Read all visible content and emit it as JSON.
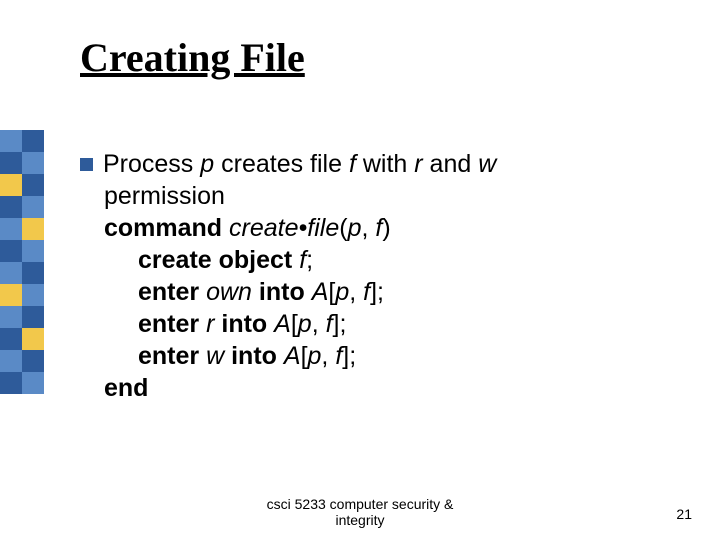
{
  "title": "Creating File",
  "bullet": {
    "lead1_a": "Process ",
    "lead1_b": "p",
    "lead1_c": " creates file ",
    "lead1_d": "f",
    "lead1_e": " with ",
    "lead1_f": "r",
    "lead1_g": " and ",
    "lead1_h": "w",
    "lead2": "permission",
    "cmd_a": "command ",
    "cmd_b": "create•file",
    "cmd_c": "(",
    "cmd_d": "p",
    "cmd_e": ", ",
    "cmd_f": "f",
    "cmd_g": ")",
    "l1_a": "create object ",
    "l1_b": "f",
    "l1_c": ";",
    "l2_a": "enter ",
    "l2_b": "own",
    "l2_c": " into ",
    "l2_d": "A",
    "l2_e": "[",
    "l2_f": "p",
    "l2_g": ", ",
    "l2_h": "f",
    "l2_i": "];",
    "l3_a": "enter ",
    "l3_b": "r",
    "l3_c": " into ",
    "l3_d": "A",
    "l3_e": "[",
    "l3_f": "p",
    "l3_g": ", ",
    "l3_h": "f",
    "l3_i": "];",
    "l4_a": "enter ",
    "l4_b": "w",
    "l4_c": " into ",
    "l4_d": "A",
    "l4_e": "[",
    "l4_f": "p",
    "l4_g": ", ",
    "l4_h": "f",
    "l4_i": "];",
    "end": "end"
  },
  "footer": {
    "line1": "csci 5233 computer security &",
    "line2": "integrity"
  },
  "pagenum": "21",
  "sidebar_colors": [
    [
      "#5a8ac6",
      "#2e5b9a"
    ],
    [
      "#2e5b9a",
      "#5a8ac6"
    ],
    [
      "#f2c84b",
      "#2e5b9a"
    ],
    [
      "#2e5b9a",
      "#5a8ac6"
    ],
    [
      "#5a8ac6",
      "#f2c84b"
    ],
    [
      "#2e5b9a",
      "#5a8ac6"
    ],
    [
      "#5a8ac6",
      "#2e5b9a"
    ],
    [
      "#f2c84b",
      "#5a8ac6"
    ],
    [
      "#5a8ac6",
      "#2e5b9a"
    ],
    [
      "#2e5b9a",
      "#f2c84b"
    ],
    [
      "#5a8ac6",
      "#2e5b9a"
    ],
    [
      "#2e5b9a",
      "#5a8ac6"
    ]
  ]
}
